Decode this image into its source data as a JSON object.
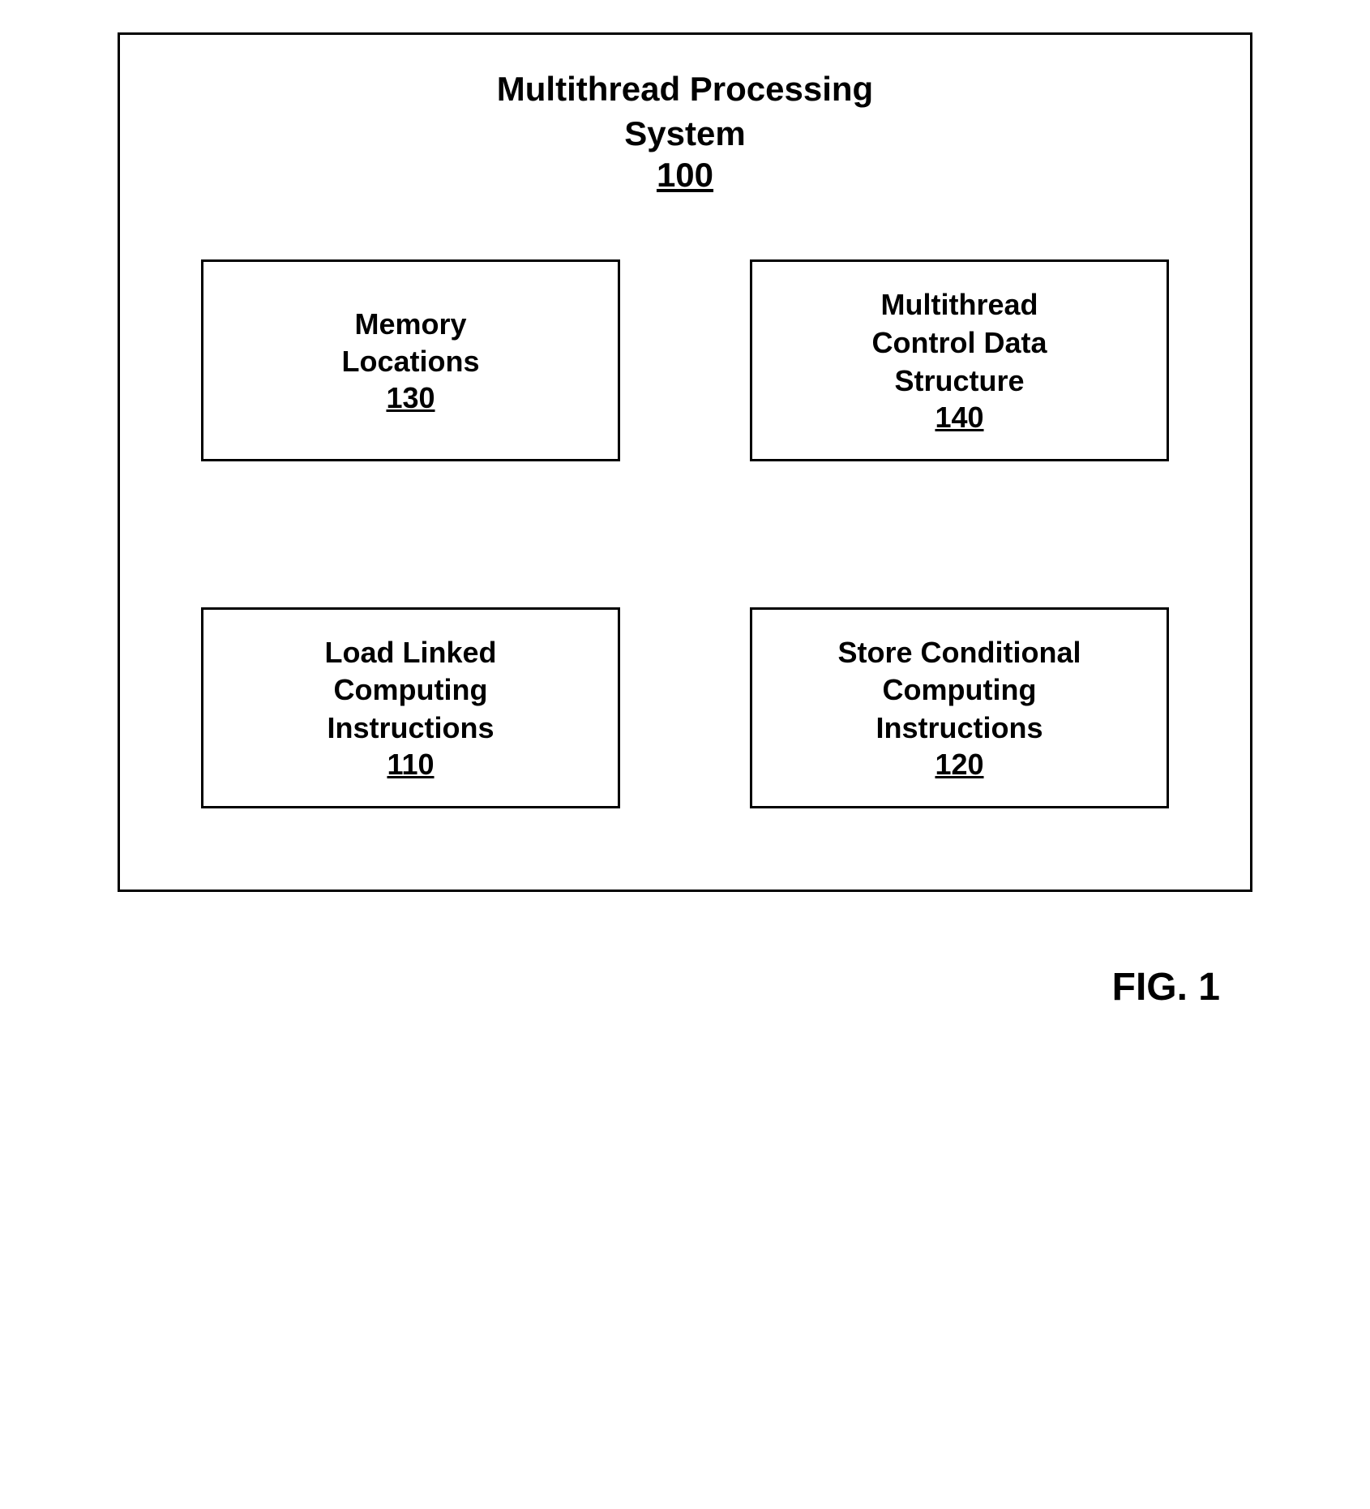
{
  "title": {
    "line1": "Multithread Processing",
    "line2": "System",
    "ref": "100"
  },
  "boxes": {
    "topLeft": {
      "line1": "Memory",
      "line2": "Locations",
      "ref": "130"
    },
    "topRight": {
      "line1": "Multithread",
      "line2": "Control Data",
      "line3": "Structure",
      "ref": "140"
    },
    "bottomLeft": {
      "line1": "Load Linked",
      "line2": "Computing",
      "line3": "Instructions",
      "ref": "110"
    },
    "bottomRight": {
      "line1": "Store Conditional",
      "line2": "Computing",
      "line3": "Instructions",
      "ref": "120"
    }
  },
  "figureLabel": "FIG. 1"
}
